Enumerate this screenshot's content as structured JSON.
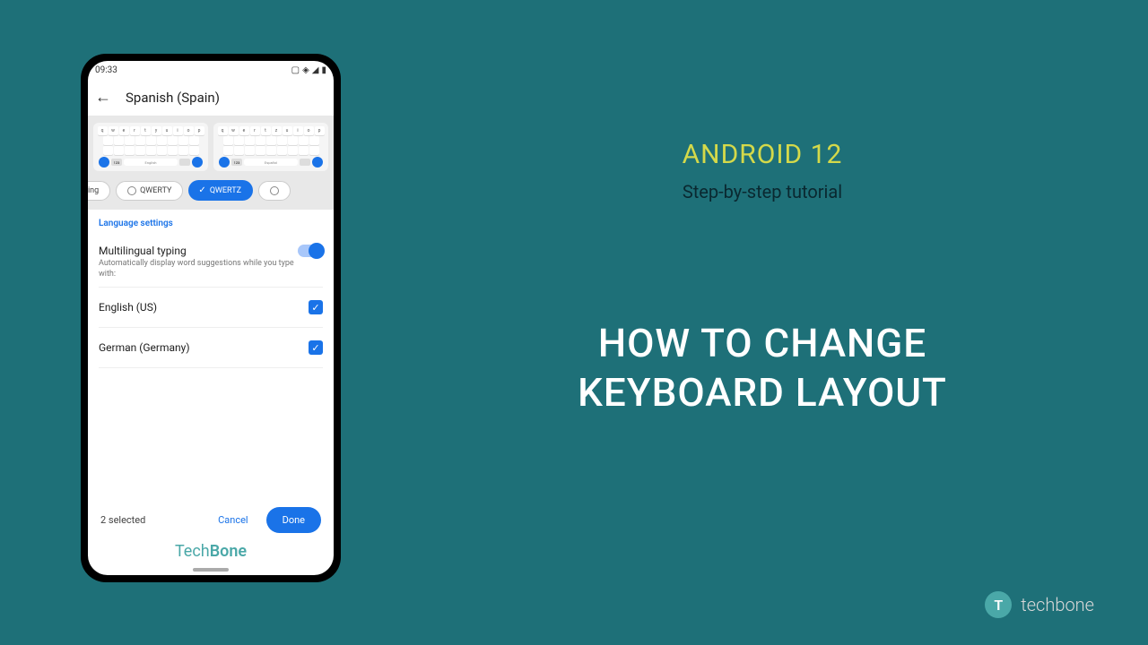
{
  "phone": {
    "status_time": "09:33",
    "header_title": "Spanish (Spain)",
    "layout_options": {
      "partial": "ting",
      "qwerty": "QWERTY",
      "qwertz": "QWERTZ"
    },
    "section_label": "Language settings",
    "multilingual": {
      "title": "Multilingual typing",
      "subtitle": "Automatically display word suggestions while you type with:"
    },
    "languages": [
      {
        "name": "English (US)"
      },
      {
        "name": "German (Germany)"
      }
    ],
    "selected_count": "2 selected",
    "cancel": "Cancel",
    "done": "Done",
    "watermark_prefix": "Tech",
    "watermark_suffix": "Bone",
    "kb_preview": {
      "row1_left": [
        "q",
        "w",
        "e",
        "r",
        "t",
        "y",
        "u",
        "i",
        "o",
        "p"
      ],
      "row1_right": [
        "q",
        "w",
        "e",
        "r",
        "t",
        "z",
        "u",
        "i",
        "o",
        "p"
      ],
      "space_left": "English",
      "space_right": "Español"
    }
  },
  "right": {
    "android": "ANDROID 12",
    "subtitle": "Step-by-step tutorial",
    "title_line1": "HOW TO CHANGE",
    "title_line2": "KEYBOARD LAYOUT"
  },
  "brand": {
    "icon_letter": "T",
    "name": "techbone"
  }
}
